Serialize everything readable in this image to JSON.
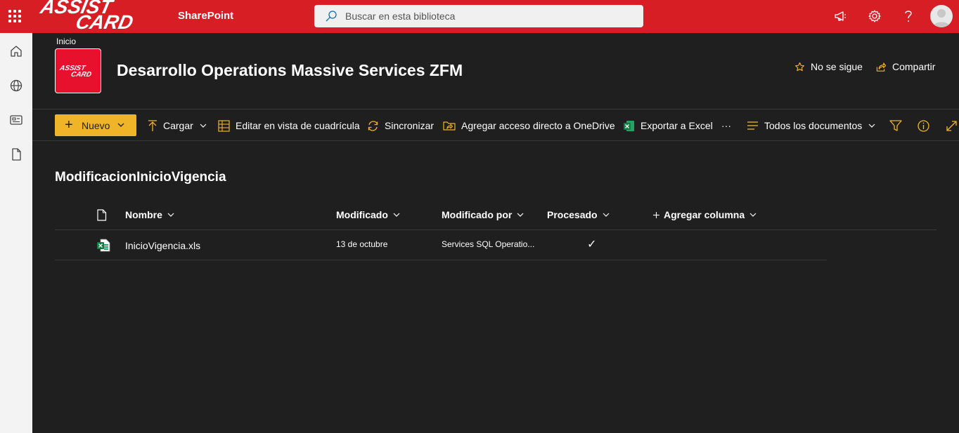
{
  "header": {
    "brand_line1": "ASSIST",
    "brand_line2": "CARD",
    "app_name": "SharePoint",
    "search_placeholder": "Buscar en esta biblioteca",
    "brand_color": "#d81e25"
  },
  "site": {
    "breadcrumb": "Inicio",
    "logo_line1": "ASSIST",
    "logo_line2": "CARD",
    "title": "Desarrollo Operations Massive Services ZFM",
    "follow_label": "No se sigue",
    "share_label": "Compartir"
  },
  "commands": {
    "new_label": "Nuevo",
    "upload_label": "Cargar",
    "grid_edit_label": "Editar en vista de cuadrícula",
    "sync_label": "Sincronizar",
    "onedrive_label": "Agregar acceso directo a OneDrive",
    "export_label": "Exportar a Excel",
    "more_label": "···",
    "view_label": "Todos los documentos",
    "accent_color": "#f0b429"
  },
  "library": {
    "title": "ModificacionInicioVigencia",
    "columns": {
      "name": "Nombre",
      "modified": "Modificado",
      "modified_by": "Modificado por",
      "processed": "Procesado",
      "add_column": "Agregar columna"
    },
    "rows": [
      {
        "file_icon": "excel-file-icon",
        "name": "InicioVigencia.xls",
        "modified": "13 de octubre",
        "modified_by": "Services SQL Operatio...",
        "processed": "✓"
      }
    ]
  }
}
